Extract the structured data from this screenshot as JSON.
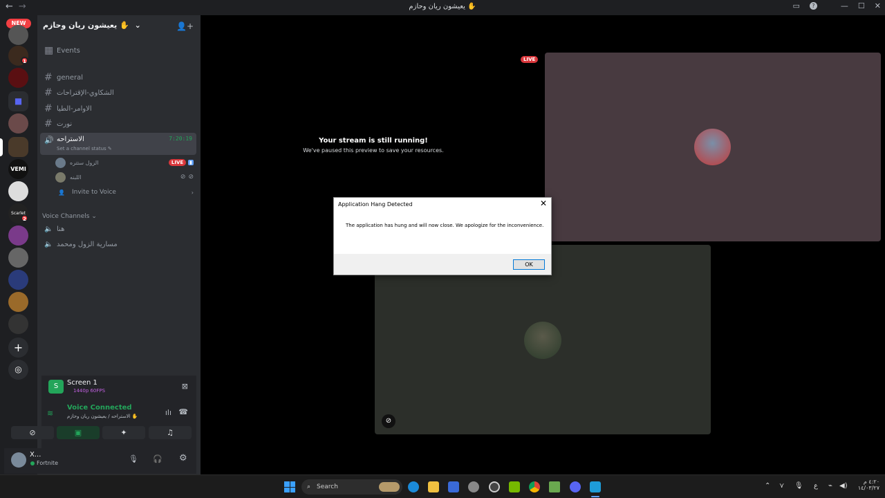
{
  "window": {
    "title": "يعيشون ريان وحازم ✋",
    "back_icon": "←",
    "forward_icon": "→"
  },
  "servers": {
    "new_label": "NEW",
    "badges": [
      "1",
      "2"
    ]
  },
  "guild": {
    "name": "يعيشون ريان وحازم ✋",
    "events_label": "Events",
    "channels": [
      {
        "name": "general"
      },
      {
        "name": "الشكاوي-الإقتراحات"
      },
      {
        "name": "الاوامر-الطيا"
      },
      {
        "name": "نورت"
      }
    ],
    "active_voice": {
      "name": "الاستراحه",
      "timer": "7:20:19",
      "status": "Set a channel status"
    },
    "voice_users": [
      {
        "name": "الزول ستتره",
        "live": "LIVE"
      },
      {
        "name": "اللبنه"
      }
    ],
    "invite_label": "Invite to Voice",
    "voice_section": "Voice Channels",
    "voice_channels": [
      "هنا",
      "مسارية الزول ومحمد"
    ]
  },
  "stream_panel": {
    "title": "Screen 1",
    "quality": "1440p 60FPS",
    "voice_connected": "Voice Connected",
    "voice_location": "الاستراحه / يعيشون ريان وحازم ✋"
  },
  "user_panel": {
    "name": "X...",
    "activity": "Fortnite"
  },
  "main": {
    "live_badge": "LIVE",
    "stream_title": "Your stream is still running!",
    "stream_sub": "We've paused this preview to save your resources."
  },
  "dialog": {
    "title": "Application Hang Detected",
    "message": "The application has hung and will now close. We apologize for the inconvenience.",
    "ok_label": "OK",
    "close": "✕"
  },
  "taskbar": {
    "search_label": "Search",
    "clock_time": "٤:٢٠ م",
    "clock_date": "١٤/٠٣/٢٧",
    "lang": "ع"
  },
  "colors": {
    "accent_green": "#23a55a",
    "live_red": "#da373c",
    "sidebar": "#2b2d31"
  }
}
